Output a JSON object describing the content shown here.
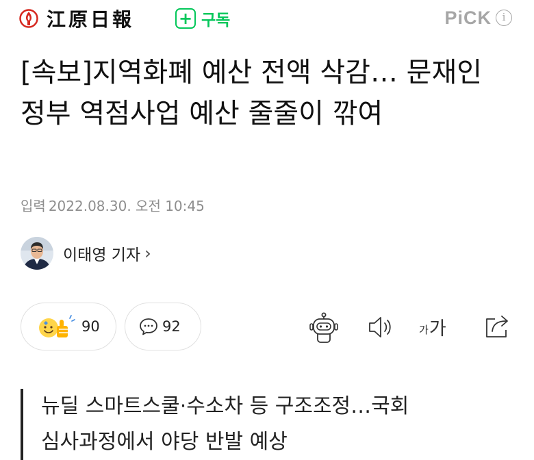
{
  "header": {
    "press_name": "江原日報",
    "logo_icon": "torch-flame-icon",
    "subscribe_label": "구독",
    "pick_label": "PiCK",
    "info_label": "i"
  },
  "article": {
    "title": "[속보]지역화폐 예산 전액 삭감… 문재인 정부 역점사업 예산 줄줄이 깎여",
    "date_label": "입력",
    "date": "2022.08.30. 오전 10:45",
    "reporter": "이태영 기자",
    "summary": "뉴딜 스마트스쿨·수소차 등 구조조정…국회 심사과정에서 야당 반발 예상"
  },
  "actions": {
    "reaction_count": "90",
    "comment_count": "92",
    "font_small": "가",
    "font_large": "가",
    "icons": [
      "reaction-emoji-icon",
      "comment-bubble-icon",
      "robot-summary-icon",
      "speaker-icon",
      "font-size-icon",
      "share-icon"
    ]
  },
  "colors": {
    "accent_green": "#03c75a",
    "logo_red": "#d6281f",
    "muted_gray": "#8e8e8e"
  }
}
